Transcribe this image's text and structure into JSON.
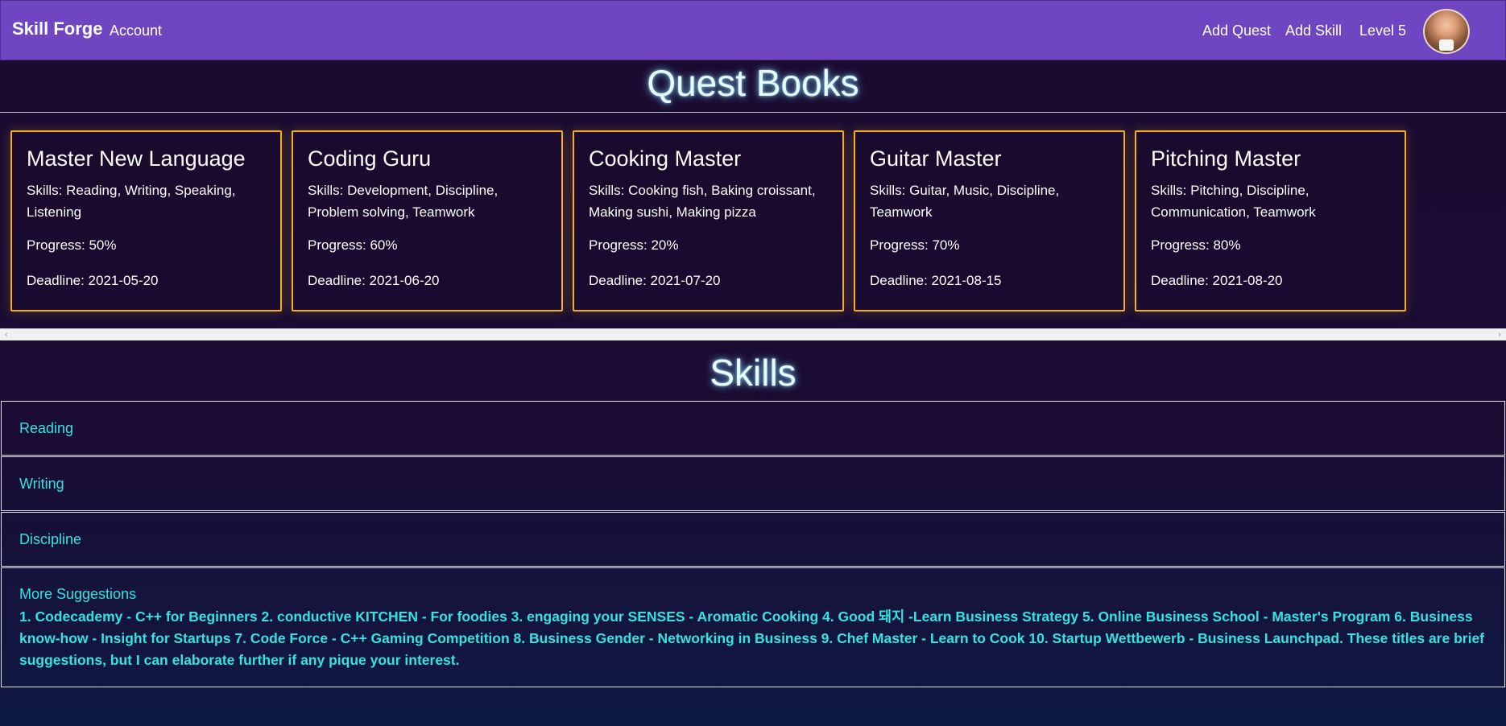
{
  "navbar": {
    "brand": "Skill Forge",
    "account": "Account",
    "add_quest": "Add Quest",
    "add_skill": "Add Skill",
    "level": "Level 5"
  },
  "quest_section": {
    "title": "Quest Books",
    "quests": [
      {
        "title": "Master New Language",
        "skills": "Skills: Reading, Writing, Speaking, Listening",
        "progress": "Progress: 50%",
        "progress_value": 50,
        "deadline": "Deadline: 2021-05-20"
      },
      {
        "title": "Coding Guru",
        "skills": "Skills: Development, Discipline, Problem solving, Teamwork",
        "progress": "Progress: 60%",
        "progress_value": 60,
        "deadline": "Deadline: 2021-06-20"
      },
      {
        "title": "Cooking Master",
        "skills": "Skills: Cooking fish, Baking croissant, Making sushi, Making pizza",
        "progress": "Progress: 20%",
        "progress_value": 20,
        "deadline": "Deadline: 2021-07-20"
      },
      {
        "title": "Guitar Master",
        "skills": "Skills: Guitar, Music, Discipline, Teamwork",
        "progress": "Progress: 70%",
        "progress_value": 70,
        "deadline": "Deadline: 2021-08-15"
      },
      {
        "title": "Pitching Master",
        "skills": "Skills: Pitching, Discipline, Communication, Teamwork",
        "progress": "Progress: 80%",
        "progress_value": 80,
        "deadline": "Deadline: 2021-08-20"
      }
    ]
  },
  "skills_section": {
    "title": "Skills",
    "items": [
      "Reading",
      "Writing",
      "Discipline"
    ],
    "suggestions_title": "More Suggestions",
    "suggestions_text": "1. Codecademy - C++ for Beginners 2. conductive KITCHEN - For foodies 3. engaging your SENSES - Aromatic Cooking 4. Good 돼지 -Learn Business Strategy 5. Online Business School - Master's Program 6. Business know-how - Insight for Startups 7. Code Force - C++ Gaming Competition 8. Business Gender - Networking in Business 9. Chef Master - Learn to Cook 10. Startup Wettbewerb - Business Launchpad. These titles are brief suggestions, but I can elaborate further if any pique your interest."
  },
  "colors": {
    "navbar": "#6f45c1",
    "background": "#1b0b30",
    "card_border": "#f2b01e",
    "accent_text": "#34e3de"
  },
  "icons": {
    "scroll_left": "‹",
    "scroll_right": "›"
  }
}
